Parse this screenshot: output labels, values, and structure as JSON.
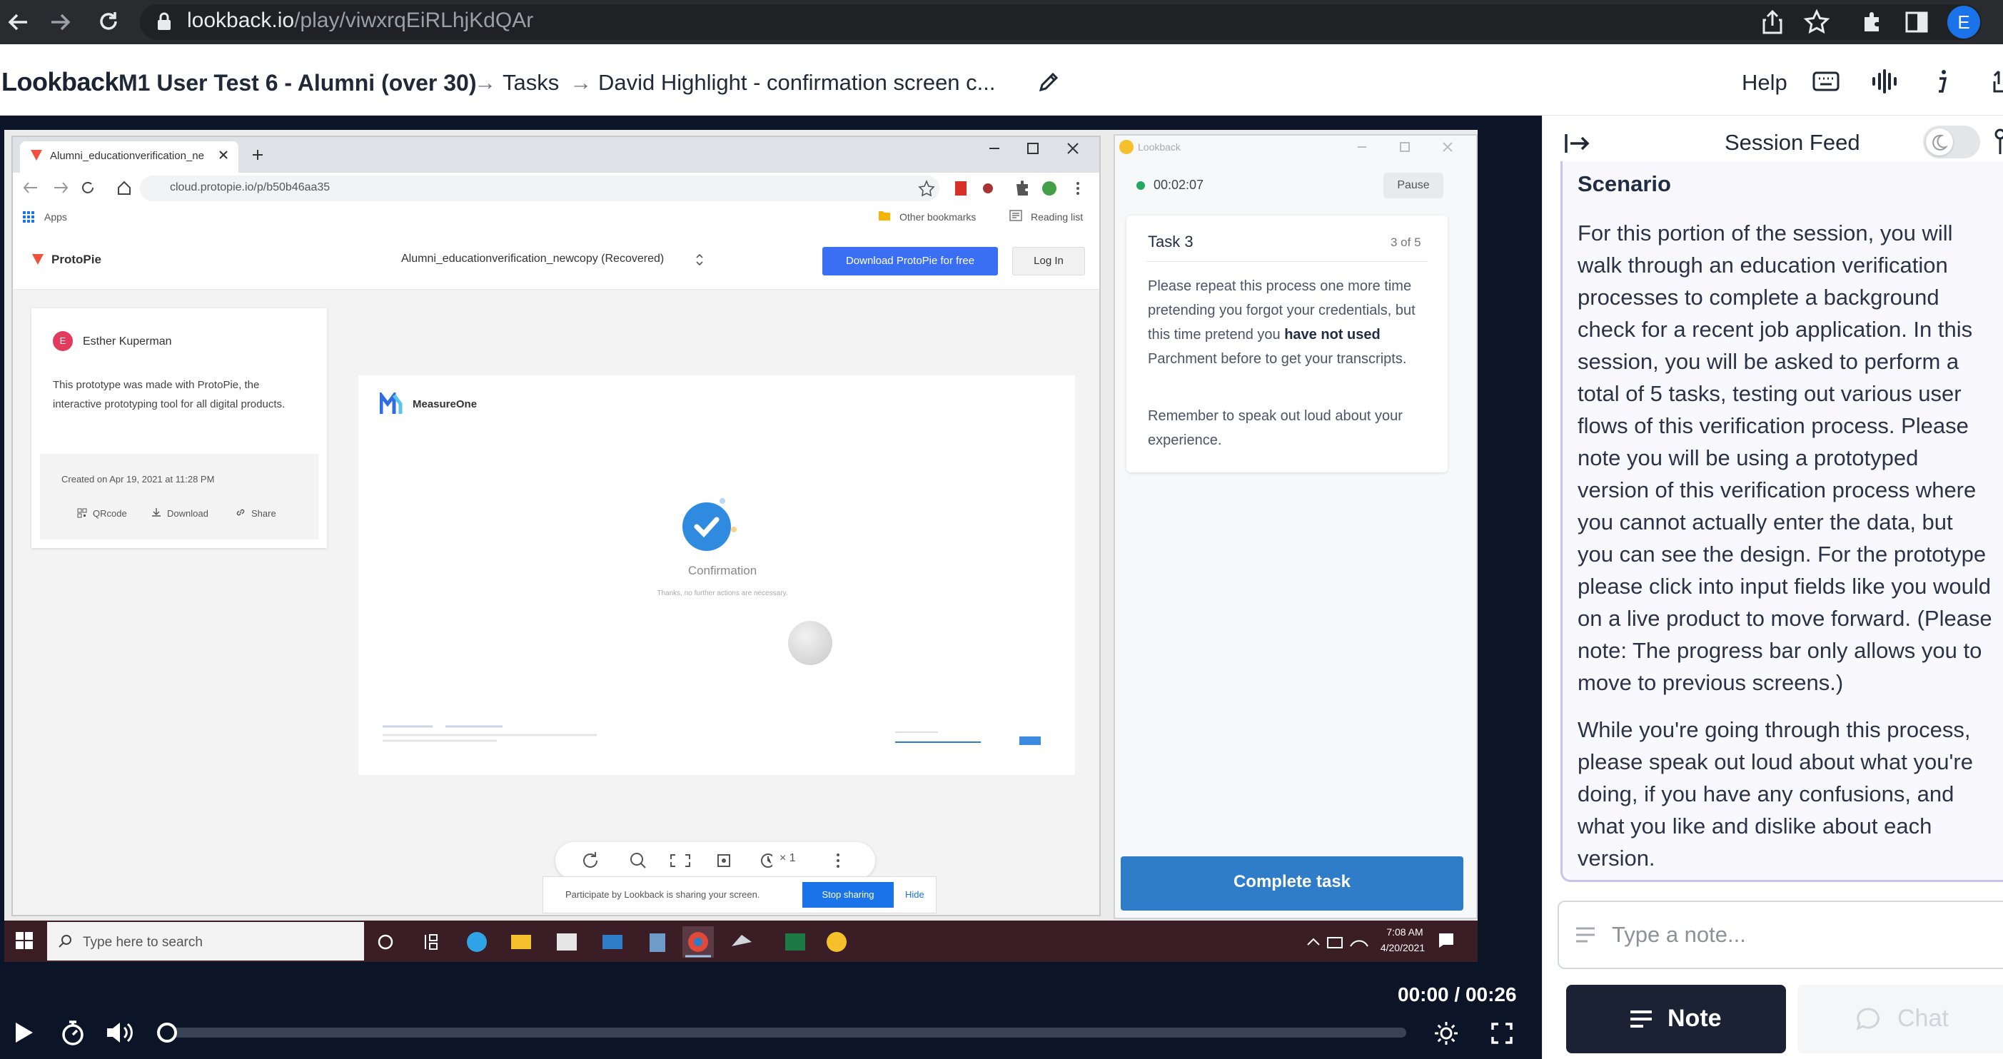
{
  "browser": {
    "url_domain": "lookback.io",
    "url_path": "/play/viwxrqEiRLhjKdQAr",
    "profile_initial": "E"
  },
  "header": {
    "logo": "Lookback",
    "breadcrumb": [
      "M1 User Test 6 - Alumni (over 30)",
      "Tasks",
      "David Highlight - confirmation screen c..."
    ],
    "separator": "→",
    "help": "Help"
  },
  "recording": {
    "inner_browser": {
      "tab_title": "Alumni_educationverification_ne",
      "address": "cloud.protopie.io/p/b50b46aa35",
      "bookmarks": [
        "Apps",
        "Other bookmarks",
        "Reading list"
      ],
      "protopie_logo": "ProtoPie",
      "file_title": "Alumni_educationverification_newcopy (Recovered)",
      "download_button": "Download ProtoPie for free",
      "login_button": "Log In",
      "author": "Esther Kuperman",
      "author_initial": "E",
      "description": "This prototype was made with ProtoPie, the interactive prototyping tool for all digital products.",
      "created": "Created on Apr 19, 2021 at 11:28 PM",
      "actions": [
        "QRcode",
        "Download",
        "Share"
      ],
      "measureone": "MeasureOne",
      "confirmation": "Confirmation",
      "confirmation_sub": "Thanks, no further actions are necessary.",
      "zoom": "× 1",
      "sharing_text": "Participate by Lookback is sharing your screen.",
      "stop_sharing": "Stop sharing",
      "hide": "Hide"
    },
    "lookback_widget": {
      "title": "Lookback",
      "timer": "00:02:07",
      "pause": "Pause",
      "task_title": "Task 3",
      "task_count": "3 of 5",
      "task_text_1": "Please repeat this process one more time pretending you forgot your credentials, but this time pretend you",
      "task_bold": "have not used",
      "task_text_2": "Parchment before to get your transcripts.",
      "task_text_3": "Remember to speak out loud about your experience.",
      "complete": "Complete task"
    },
    "taskbar": {
      "search": "Type here to search",
      "time": "7:08 AM",
      "date": "4/20/2021"
    }
  },
  "player": {
    "time": "00:00 / 00:26",
    "progress": 0.0
  },
  "panel": {
    "title": "Session Feed",
    "scenario_title": "Scenario",
    "scenario_p1": "For this portion of the session, you will walk through an education verification processes to complete a background check for a recent job application. In this session, you will be asked to perform a total of 5 tasks, testing out various user flows of this verification process. Please note you will be using a prototyped version of this verification process where you cannot actually enter the data, but you can see the design. For the prototype please click into input fields like you would on a live product to move forward. (Please note: The progress bar only allows you to move to previous screens.)",
    "scenario_p2": "While you're going through this process, please speak out loud about what you're doing, if you have any confusions, and what you like and dislike about each version.",
    "note_placeholder": "Type a note...",
    "note_button": "Note",
    "chat_button": "Chat"
  },
  "colors": {
    "accent_blue": "#2f7dc9",
    "dark_navy": "#1b2233",
    "panel_border": "#c7c3ee"
  }
}
